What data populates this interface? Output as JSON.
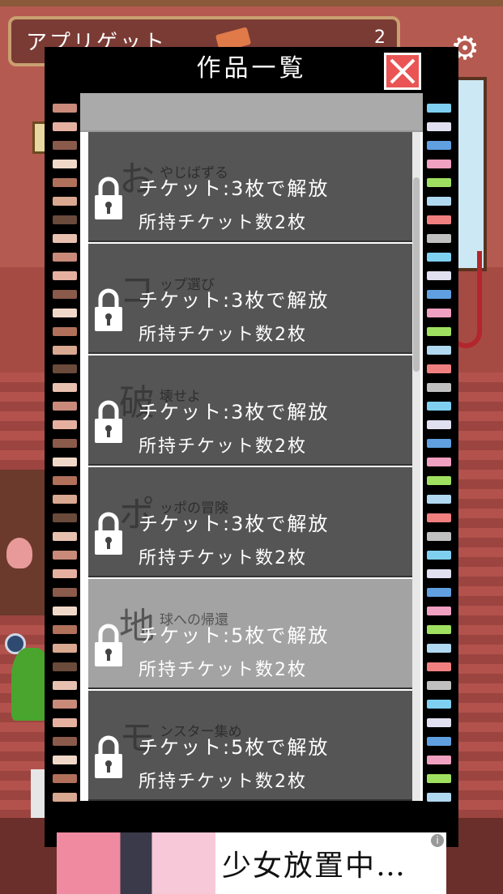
{
  "background": {
    "app_banner_title": "アプリゲット",
    "ticket_count": "2",
    "settings_icon": "gear-icon"
  },
  "modal": {
    "title": "作品一覧",
    "close_icon": "close-icon",
    "items": [
      {
        "kanji": "お",
        "title": "やじばずる",
        "unlock": "チケット:3枚で解放",
        "held": "所持チケット数2枚",
        "locked": true
      },
      {
        "kanji": "コ",
        "title": "ップ選び",
        "unlock": "チケット:3枚で解放",
        "held": "所持チケット数2枚",
        "locked": true
      },
      {
        "kanji": "破",
        "title": "壊せよ",
        "unlock": "チケット:3枚で解放",
        "held": "所持チケット数2枚",
        "locked": true
      },
      {
        "kanji": "ポ",
        "title": "ッポの冒険",
        "unlock": "チケット:3枚で解放",
        "held": "所持チケット数2枚",
        "locked": true
      },
      {
        "kanji": "地",
        "title": "球への帰還",
        "unlock": "チケット:5枚で解放",
        "held": "所持チケット数2枚",
        "locked": true
      },
      {
        "kanji": "モ",
        "title": "ンスター集め",
        "unlock": "チケット:5枚で解放",
        "held": "所持チケット数2枚",
        "locked": true
      }
    ]
  },
  "ad": {
    "text": "少女放置中…",
    "info_icon": "info-icon"
  },
  "colors": {
    "close_button": "#ea5454",
    "item_background": "#555555",
    "item_highlight": "#a3a3a3",
    "modal_background": "#000000"
  }
}
